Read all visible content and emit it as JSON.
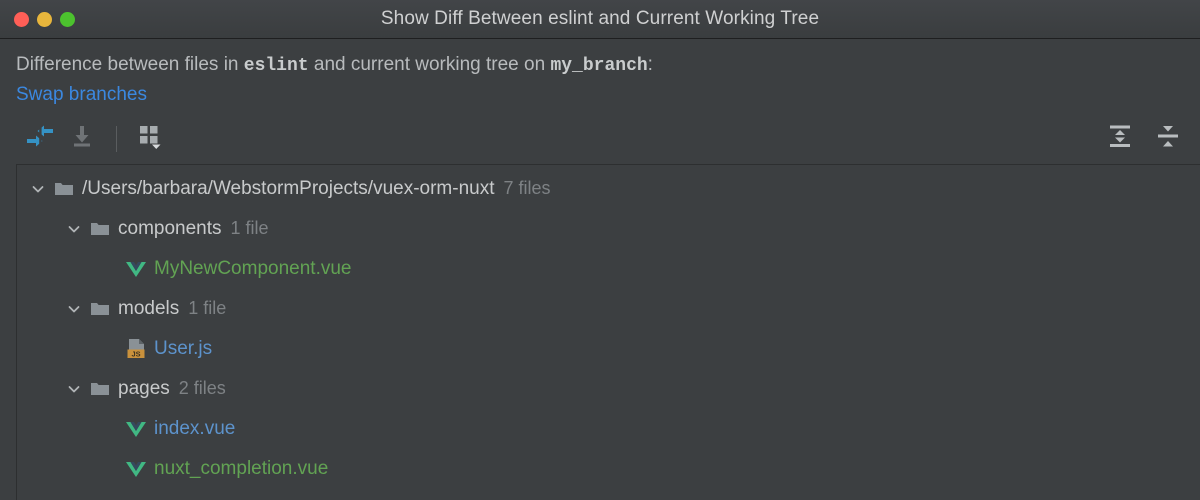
{
  "window": {
    "title": "Show Diff Between eslint and Current Working Tree",
    "controls": {
      "close": "close-button",
      "minimize": "minimize-button",
      "zoom": "zoom-button"
    },
    "colors": {
      "close": "#ff5f57",
      "minimize": "#e8b63c",
      "zoom": "#4cc22e",
      "background": "#3c3f41",
      "titlebar": "#414447",
      "accent_link": "#3b88e0",
      "file_added": "#62a353",
      "file_modified": "#5d93cc",
      "icon_blue": "#3592c4",
      "js_badge": "#c9913c",
      "vue_green": "#41b883"
    }
  },
  "header": {
    "description_part1": "Difference between files in ",
    "branch_name": "eslint",
    "description_part2": " and current working tree on ",
    "current_branch": "my_branch",
    "description_part3": ":",
    "swap_link": "Swap branches"
  },
  "toolbar": {
    "left": [
      {
        "name": "show-diff-button",
        "icon": "compare-arrows-icon",
        "disabled": false
      },
      {
        "name": "get-from-branch-button",
        "icon": "download-icon",
        "disabled": true
      },
      {
        "name": "group-by-button",
        "icon": "group-by-icon",
        "disabled": false
      }
    ],
    "right": [
      {
        "name": "expand-all-button",
        "icon": "expand-all-icon"
      },
      {
        "name": "collapse-all-button",
        "icon": "collapse-all-icon"
      }
    ]
  },
  "tree": {
    "root": {
      "label": "/Users/barbara/WebstormProjects/vuex-orm-nuxt",
      "count": "7 files",
      "expanded": true,
      "icon": "folder-icon"
    },
    "groups": [
      {
        "label": "components",
        "count": "1 file",
        "expanded": true,
        "icon": "folder-icon",
        "files": [
          {
            "name": "MyNewComponent.vue",
            "icon": "vue-file-icon",
            "status": "added"
          }
        ]
      },
      {
        "label": "models",
        "count": "1 file",
        "expanded": true,
        "icon": "folder-icon",
        "files": [
          {
            "name": "User.js",
            "icon": "js-file-icon",
            "status": "modified"
          }
        ]
      },
      {
        "label": "pages",
        "count": "2 files",
        "expanded": true,
        "icon": "folder-icon",
        "files": [
          {
            "name": "index.vue",
            "icon": "vue-file-icon",
            "status": "modified"
          },
          {
            "name": "nuxt_completion.vue",
            "icon": "vue-file-icon",
            "status": "added"
          }
        ]
      }
    ]
  }
}
